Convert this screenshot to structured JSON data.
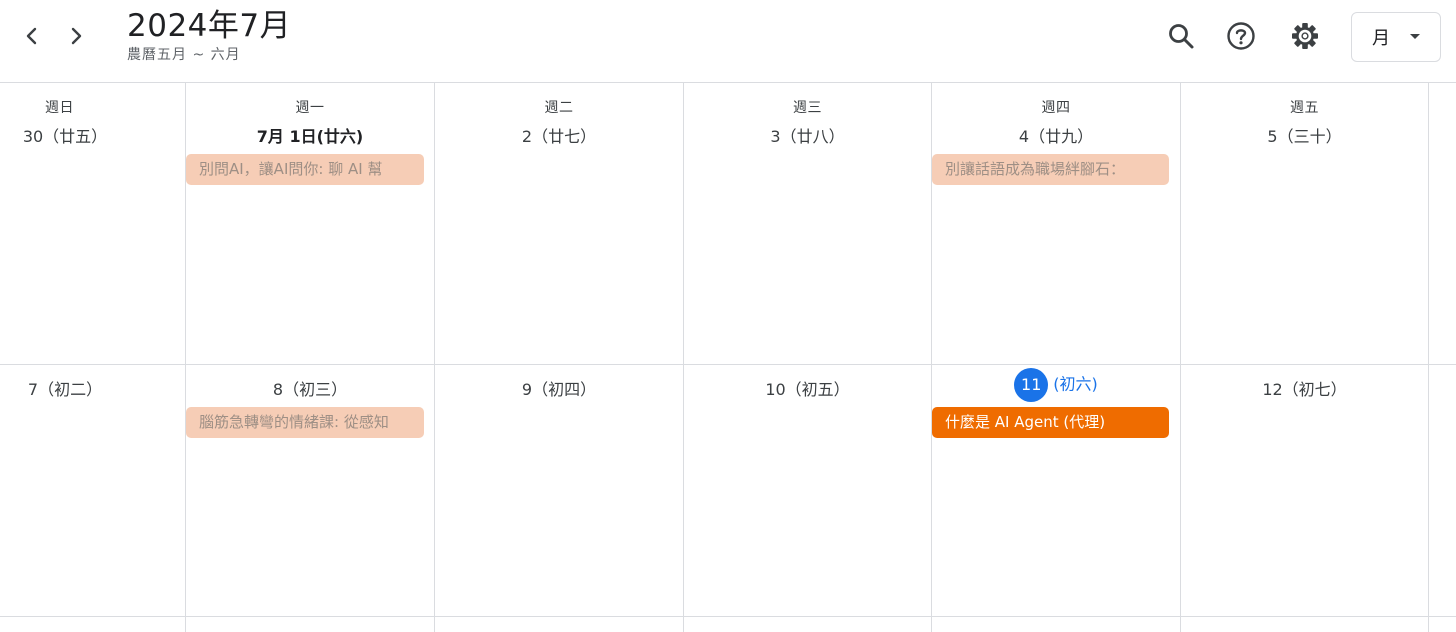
{
  "header": {
    "prev_label": "previous",
    "next_label": "next",
    "title": "2024年7月",
    "subtitle": "農曆五月 ~ 六月",
    "view_select": "月"
  },
  "colors": {
    "today_bg": "#1a73e8",
    "event_active": "#ef6c00",
    "event_past": "#f6cdb6"
  },
  "week1": {
    "days": [
      {
        "dow": "週日",
        "date": "30（廿五）"
      },
      {
        "dow": "週一",
        "date": "7月 1日(廿六)"
      },
      {
        "dow": "週二",
        "date": "2（廿七）"
      },
      {
        "dow": "週三",
        "date": "3（廿八）"
      },
      {
        "dow": "週四",
        "date": "4（廿九）"
      },
      {
        "dow": "週五",
        "date": "5（三十）"
      }
    ],
    "events": [
      {
        "day": "週一",
        "title": "別問AI，讓AI問你: 聊 AI 幫"
      },
      {
        "day": "週四",
        "title": "別讓話語成為職場絆腳石："
      }
    ]
  },
  "week2": {
    "days": [
      {
        "date": "7（初二）"
      },
      {
        "date": "8（初三）"
      },
      {
        "date": "9（初四）"
      },
      {
        "date": "10（初五）"
      },
      {
        "today_num": "11",
        "lunar": "(初六)"
      },
      {
        "date": "12（初七）"
      }
    ],
    "events": [
      {
        "day": "週一",
        "title": "腦筋急轉彎的情緒課: 從感知"
      },
      {
        "day": "週四",
        "title": "什麼是 AI Agent (代理)"
      }
    ]
  }
}
